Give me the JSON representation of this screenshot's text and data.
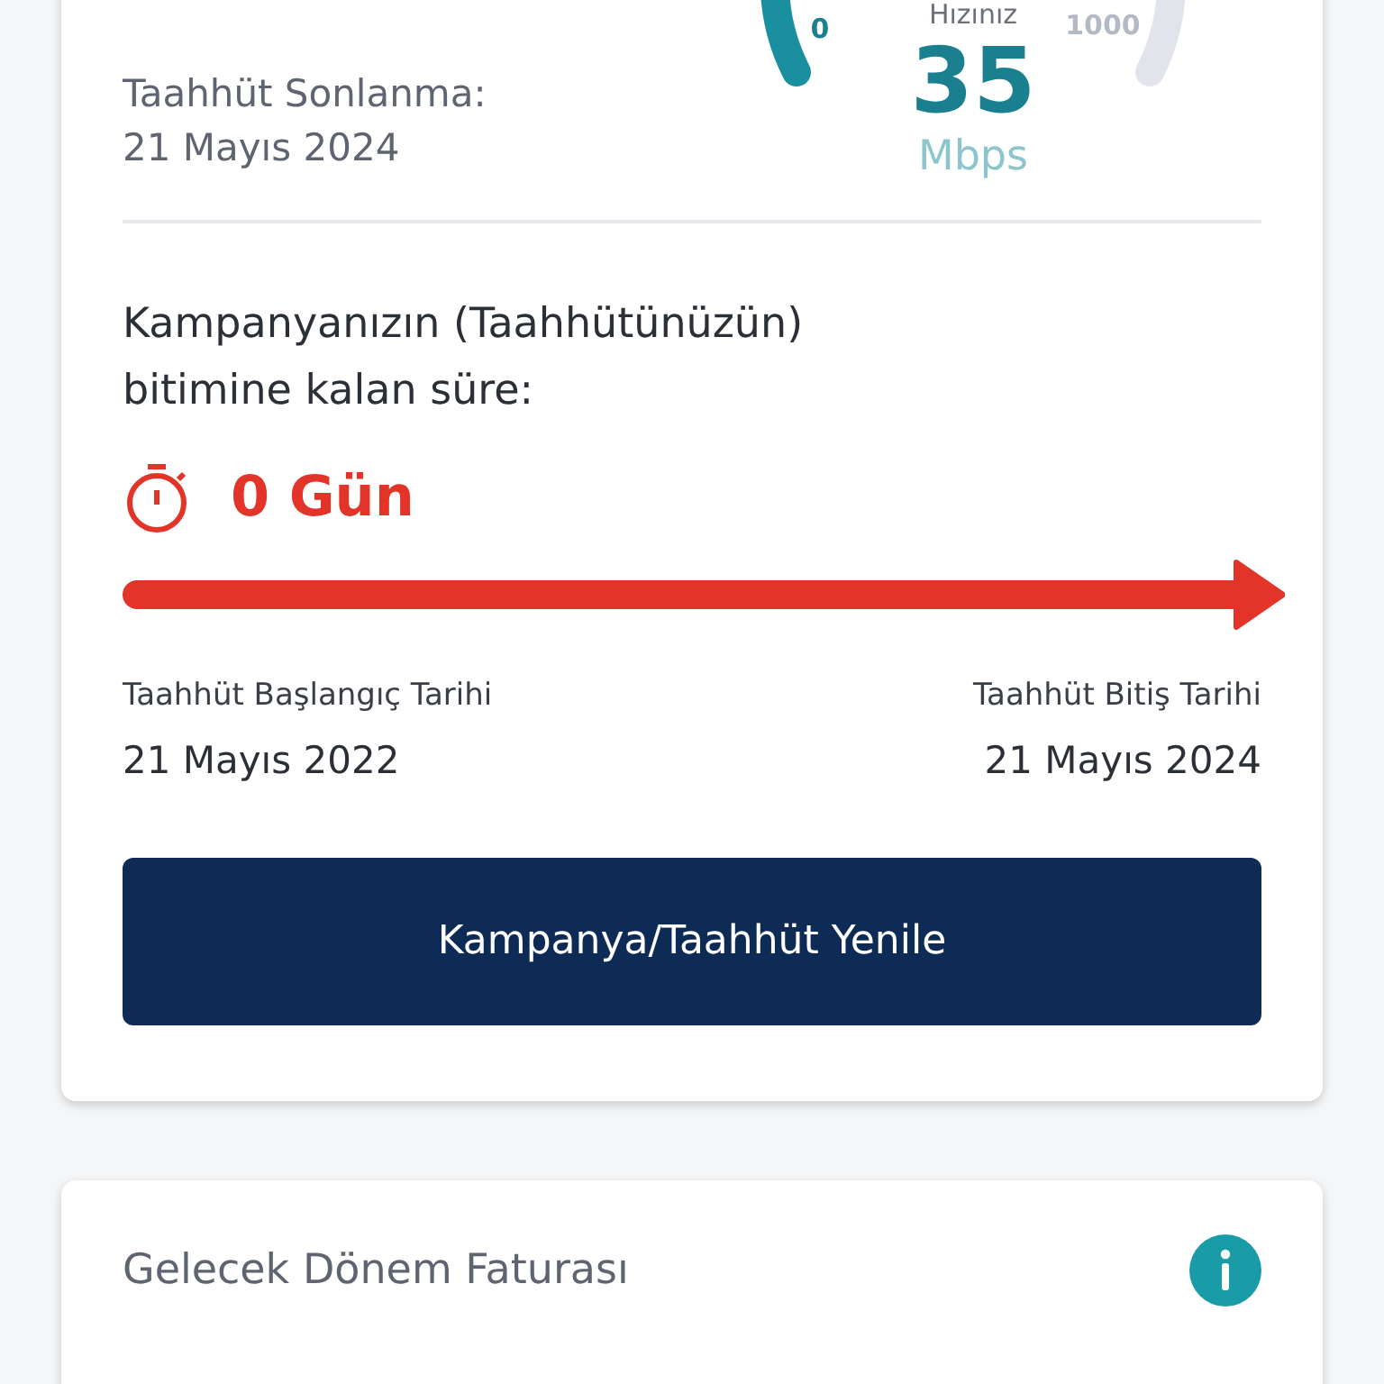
{
  "commitment_end": {
    "label": "Taahhüt Sonlanma:",
    "date": "21 Mayıs 2024"
  },
  "speed_gauge": {
    "min_label": "0",
    "max_label": "1000",
    "caption": "Hızınız",
    "value": "35",
    "unit": "Mbps"
  },
  "remaining": {
    "title": "Kampanyanızın (Taahhütünüzün) bitimine kalan süre:",
    "days": "0 Gün"
  },
  "dates": [
    {
      "label": "Taahhüt Başlangıç Tarihi",
      "date": "21 Mayıs 2022"
    },
    {
      "label": "Taahhüt Bitiş Tarihi",
      "date": "21 Mayıs 2024"
    }
  ],
  "renew_button": "Kampanya/Taahhüt Yenile",
  "next_invoice": {
    "title": "Gelecek Dönem Faturası"
  }
}
